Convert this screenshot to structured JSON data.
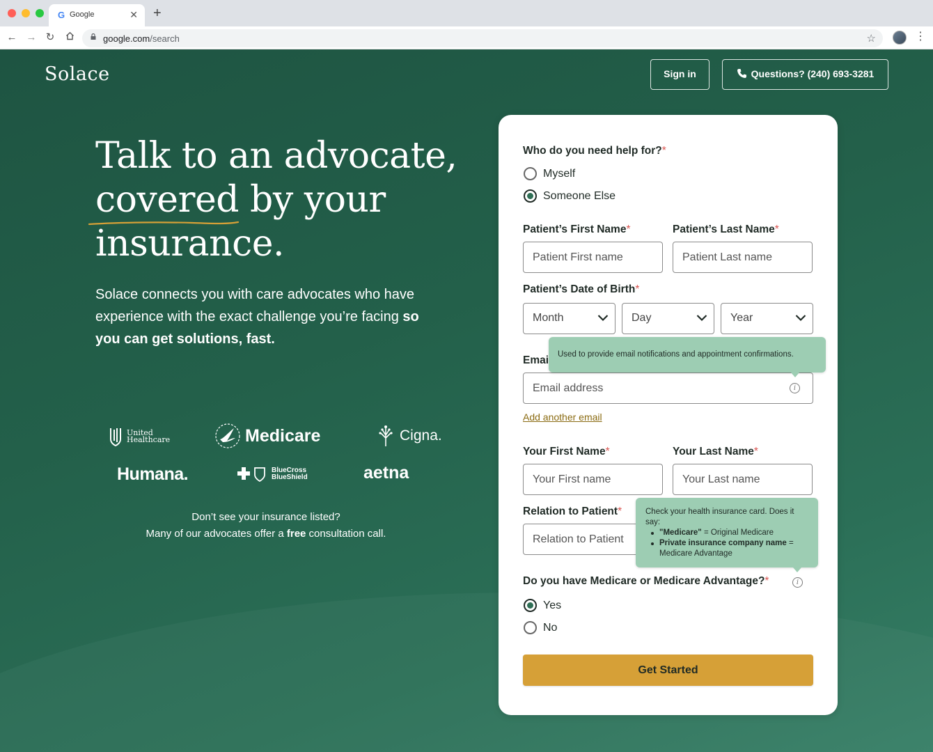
{
  "browser": {
    "tab_title": "Google",
    "tab_favicon": "G",
    "url_host": "google.com",
    "url_path": "/search",
    "icons": [
      "back-icon",
      "forward-icon",
      "reload-icon",
      "home-icon",
      "lock-icon",
      "star-icon",
      "profile-avatar",
      "menu-dots-icon"
    ]
  },
  "header": {
    "logo": "Solace",
    "signin_label": "Sign in",
    "phone_label": "Questions? (240) 693-3281"
  },
  "hero": {
    "headline": "Talk to an advocate, covered by your insurance.",
    "subtext_regular": "Solace connects you with care advocates who have experience with the exact challenge you’re facing ",
    "subtext_bold": "so you can get solutions, fast."
  },
  "insurers": {
    "uhc_line1": "United",
    "uhc_line2": "Healthcare",
    "medicare": "Medicare",
    "cigna": "Cigna.",
    "humana": "Humana.",
    "bcbs_line1": "BlueCross",
    "bcbs_line2": "BlueShield",
    "aetna": "aetna"
  },
  "insurance_note": {
    "line1": "Don’t see your insurance listed?",
    "line2_a": "Many of our advocates offer a ",
    "line2_bold": "free",
    "line2_b": " consultation call."
  },
  "form": {
    "who_label": "Who do you need help for?",
    "who_options": [
      {
        "label": "Myself",
        "selected": false
      },
      {
        "label": "Someone Else",
        "selected": true
      }
    ],
    "patient_first_label": "Patient’s First Name",
    "patient_first_placeholder": "Patient First name",
    "patient_last_label": "Patient’s Last Name",
    "patient_last_placeholder": "Patient Last name",
    "dob_label": "Patient’s Date of Birth",
    "dob_month": "Month",
    "dob_day": "Day",
    "dob_year": "Year",
    "email_label": "Email",
    "email_placeholder": "Email address",
    "email_tooltip": "Used to provide email notifications and appointment confirmations.",
    "add_email_link": "Add another email",
    "your_first_label": "Your First Name",
    "your_first_placeholder": "Your First name",
    "your_last_label": "Your Last Name",
    "your_last_placeholder": "Your Last name",
    "relation_label": "Relation to Patient",
    "relation_placeholder": "Relation to Patient",
    "medicare_tooltip_intro": "Check your health insurance card. Does it say:",
    "medicare_tooltip_item1_bold": "\"Medicare\"",
    "medicare_tooltip_item1_rest": " = Original Medicare",
    "medicare_tooltip_item2_bold": "Private insurance company name",
    "medicare_tooltip_item2_rest": " = Medicare Advantage",
    "medicare_label": "Do you have Medicare or Medicare Advantage?",
    "medicare_options": [
      {
        "label": "Yes",
        "selected": true
      },
      {
        "label": "No",
        "selected": false
      }
    ],
    "required_mark": "*",
    "submit_label": "Get Started"
  },
  "colors": {
    "background": "#23604a",
    "accent_button": "#d6a037",
    "tooltip": "#9dcdb3",
    "required": "#d9534f"
  }
}
